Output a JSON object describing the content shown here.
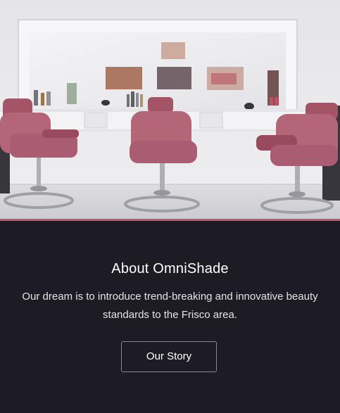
{
  "hero": {
    "image": "salon-interior-photo",
    "accent_color": "#c2566e"
  },
  "about": {
    "title": "About OmniShade",
    "text": "Our dream is to introduce trend-breaking and innovative beauty standards to the Frisco area.",
    "button_label": "Our Story"
  },
  "colors": {
    "background": "#1d1c25",
    "text": "#ffffff"
  }
}
